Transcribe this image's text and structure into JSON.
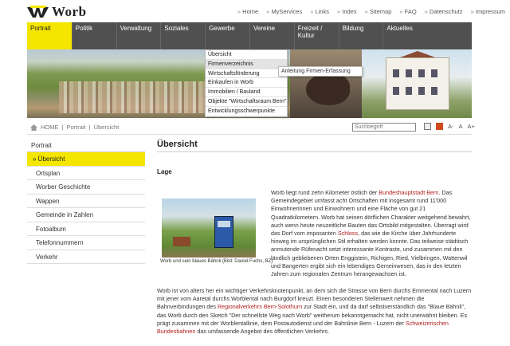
{
  "brand": {
    "logo_text": "Worb"
  },
  "topnav": [
    "Home",
    "MyServices",
    "Links",
    "Index",
    "Sitemap",
    "FAQ",
    "Datenschutz",
    "Impressum"
  ],
  "mainnav": [
    "Portrait",
    "Politik",
    "Verwaltung",
    "Soziales",
    "Gewerbe",
    "Vereine",
    "Freizeit / Kultur",
    "Bildung",
    "Aktuelles"
  ],
  "dropdown": {
    "items": [
      "Übersicht",
      "Firmenverzeichnis",
      "Wirtschaftsförderung",
      "Einkaufen in Worb",
      "Immobilien / Bauland",
      "Objekte \"Wirtschaftsraum Bern\"",
      "Entwicklungsschwerpunkte"
    ],
    "flyout": "Anleitung Firmen-Erfassung"
  },
  "breadcrumb": {
    "home": "HOME",
    "sep": "|",
    "level1": "Portrait",
    "level2": "Übersicht"
  },
  "search": {
    "placeholder": "Suchbegriff"
  },
  "tools": {
    "font_decrease": "A-",
    "font_normal": "A",
    "font_increase": "A+"
  },
  "sidebar": {
    "section": "Portrait",
    "items": [
      "Übersicht",
      "Ortsplan",
      "Worber Geschichte",
      "Wappen",
      "Gemeinde in Zahlen",
      "Fotoalbum",
      "Telefonnummern",
      "Verkehr"
    ]
  },
  "content": {
    "title": "Übersicht",
    "subtitle": "Lage",
    "caption": "Worb und sein blaues Bähnli (Bild: Daniel Fuchs, BZ)",
    "p1_a": "Worb liegt rund zehn Kilometer östlich der ",
    "p1_link1": "Bundeshauptstadt Bern",
    "p1_b": ". Das Gemeindegebiet umfasst acht Ortschaften mit insgesamt rund 11'000 Einwohnerinnen und Einwohnern und eine Fläche von gut 21 Quadratkilometern. Worb hat seinen dörflichen Charakter weitgehend bewahrt, auch wenn heute neuzeitliche Bauten das Ortsbild mitgestalten. Überragt wird das Dorf vom imposanten ",
    "p1_link2": "Schloss",
    "p1_c": ", das wie die Kirche über Jahrhunderte hinweg im ursprünglichen Stil erhalten werden konnte. Das teilweise städtisch anmutende Rüfenacht setzt interessante Kontraste, und zusammen mit den ländlich gebliebenen Orten Enggistein, Richigen, Ried, Vielbringen, Wattenwil und Bangerten ergibt sich ein lebendiges Gemeinwesen, das in den letzten Jahren zum regionalen Zentrum herangewachsen ist.",
    "p2_a": "Worb ist von alters her ein wichtiger Verkehrsknotenpunkt, an dem sich die Strasse von Bern durchs Emmental nach Luzern mit jener vom Aaretal durchs Worblental nach Burgdorf kreuzt. Einen besonderen Stellenwert nehmen die Bahnverbindungen des ",
    "p2_link1": "Regionalverkehrs Bern-Solothurn",
    "p2_b": " zur Stadt ein, und da darf selbstverständlich das \"Blaue Bähnli\", das Worb durch den Sketch \"Der schnellste Weg nach Worb\" weitherum bekanntgemacht hat, nicht unerwähnt bleiben. Es prägt zusammen mit der Worblentallinie, dem Postautodienst und der Bahnlinie Bern - Luzern der ",
    "p2_link2": "Schweizerischen Bundesbahnen",
    "p2_c": " das umfassende Angebot des öffentlichen Verkehrs."
  },
  "colors": {
    "accent": "#f5e600",
    "nav_bg": "#505050",
    "link_red": "#b01c1c"
  }
}
